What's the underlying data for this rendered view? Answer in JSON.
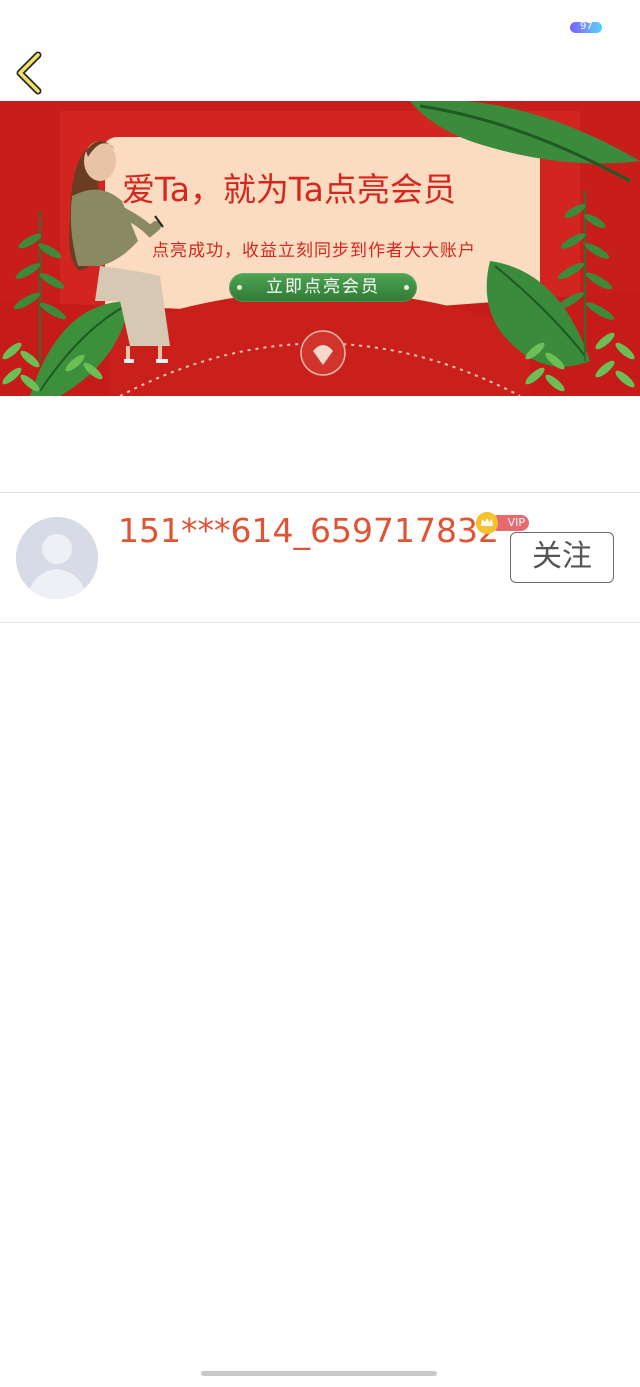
{
  "status_bar": {
    "battery_level": "97",
    "battery_icon": "battery-icon"
  },
  "header": {
    "back_icon": "chevron-left-icon"
  },
  "banner": {
    "title": "爱Ta，就为Ta点亮会员",
    "subtitle": "点亮成功，收益立刻同步到作者大大账户",
    "cta_label": "立即点亮会员",
    "colors": {
      "background_red": "#c9201c",
      "card_peach": "#fbdcc0",
      "text_red": "#d5271f",
      "cta_green": "#3a8c3f"
    }
  },
  "user": {
    "username": "151***614_659717832",
    "vip_label": "VIP",
    "follow_label": "关注",
    "avatar_icon": "default-avatar-icon",
    "username_color": "#e05436"
  }
}
